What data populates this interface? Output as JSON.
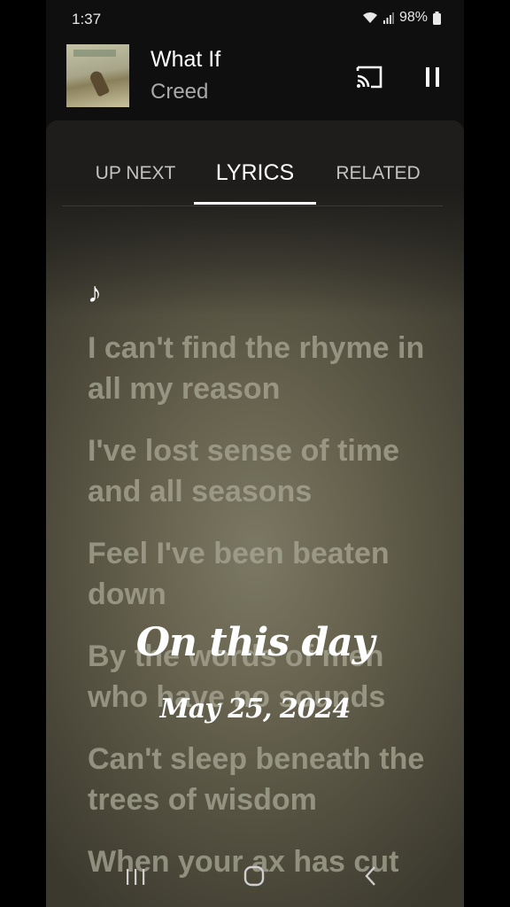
{
  "status_bar": {
    "time": "1:37",
    "battery": "98%",
    "icons": [
      "wifi-icon",
      "signal-icon",
      "battery-icon"
    ]
  },
  "now_playing": {
    "title": "What If",
    "artist": "Creed",
    "icons": [
      "cast-icon",
      "pause-icon"
    ]
  },
  "tabs": [
    {
      "label": "UP NEXT",
      "selected": false
    },
    {
      "label": "LYRICS",
      "selected": true
    },
    {
      "label": "RELATED",
      "selected": false
    }
  ],
  "lyrics": {
    "note_glyph": "♪",
    "lines": [
      "I can't find the rhyme in all my reason",
      "I've lost sense of time and all seasons",
      "Feel I've been beaten down",
      "By the words of men who have no sounds",
      "Can't sleep beneath the trees of wisdom",
      "When your ax has cut"
    ]
  },
  "overlay": {
    "title": "On this day",
    "date": "May 25, 2024"
  },
  "nav_bar": {
    "icons": [
      "recents-icon",
      "home-icon",
      "back-icon"
    ]
  },
  "colors": {
    "background": "#000000",
    "panel": "#67634f",
    "lyric_text": "#aaa896",
    "accent": "#ffffff"
  }
}
